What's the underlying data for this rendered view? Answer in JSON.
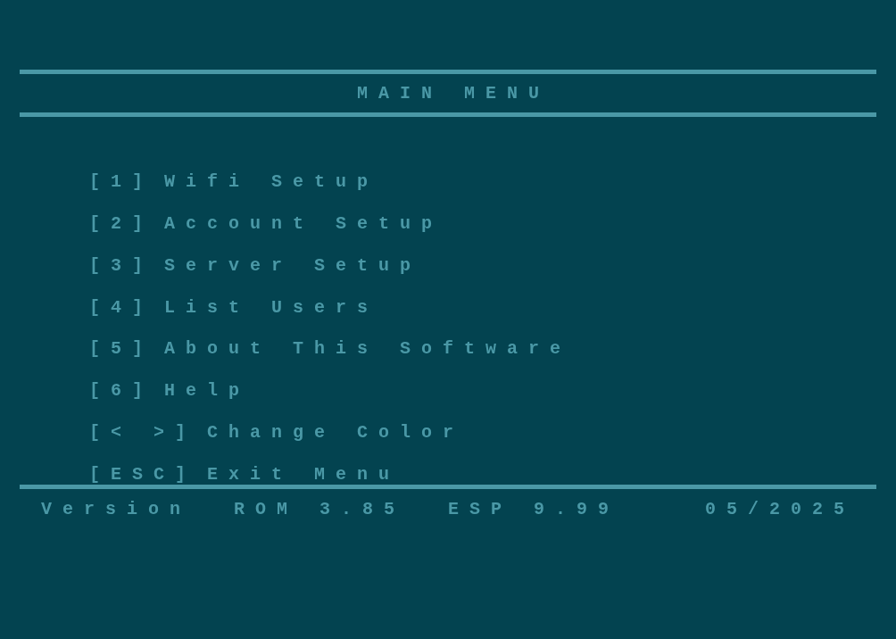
{
  "title": "MAIN MENU",
  "menu_items": [
    {
      "key": "[1]",
      "label": "Wifi Setup"
    },
    {
      "key": "[2]",
      "label": "Account Setup"
    },
    {
      "key": "[3]",
      "label": "Server Setup"
    },
    {
      "key": "[4]",
      "label": "List Users"
    },
    {
      "key": "[5]",
      "label": "About This Software"
    },
    {
      "key": "[6]",
      "label": "Help"
    },
    {
      "key": "[< >]",
      "label": "Change Color"
    },
    {
      "key": "[ESC]",
      "label": "Exit Menu"
    }
  ],
  "status_bar": [
    "Version",
    "ROM 3.85",
    "ESP 9.99",
    "05/2025"
  ]
}
